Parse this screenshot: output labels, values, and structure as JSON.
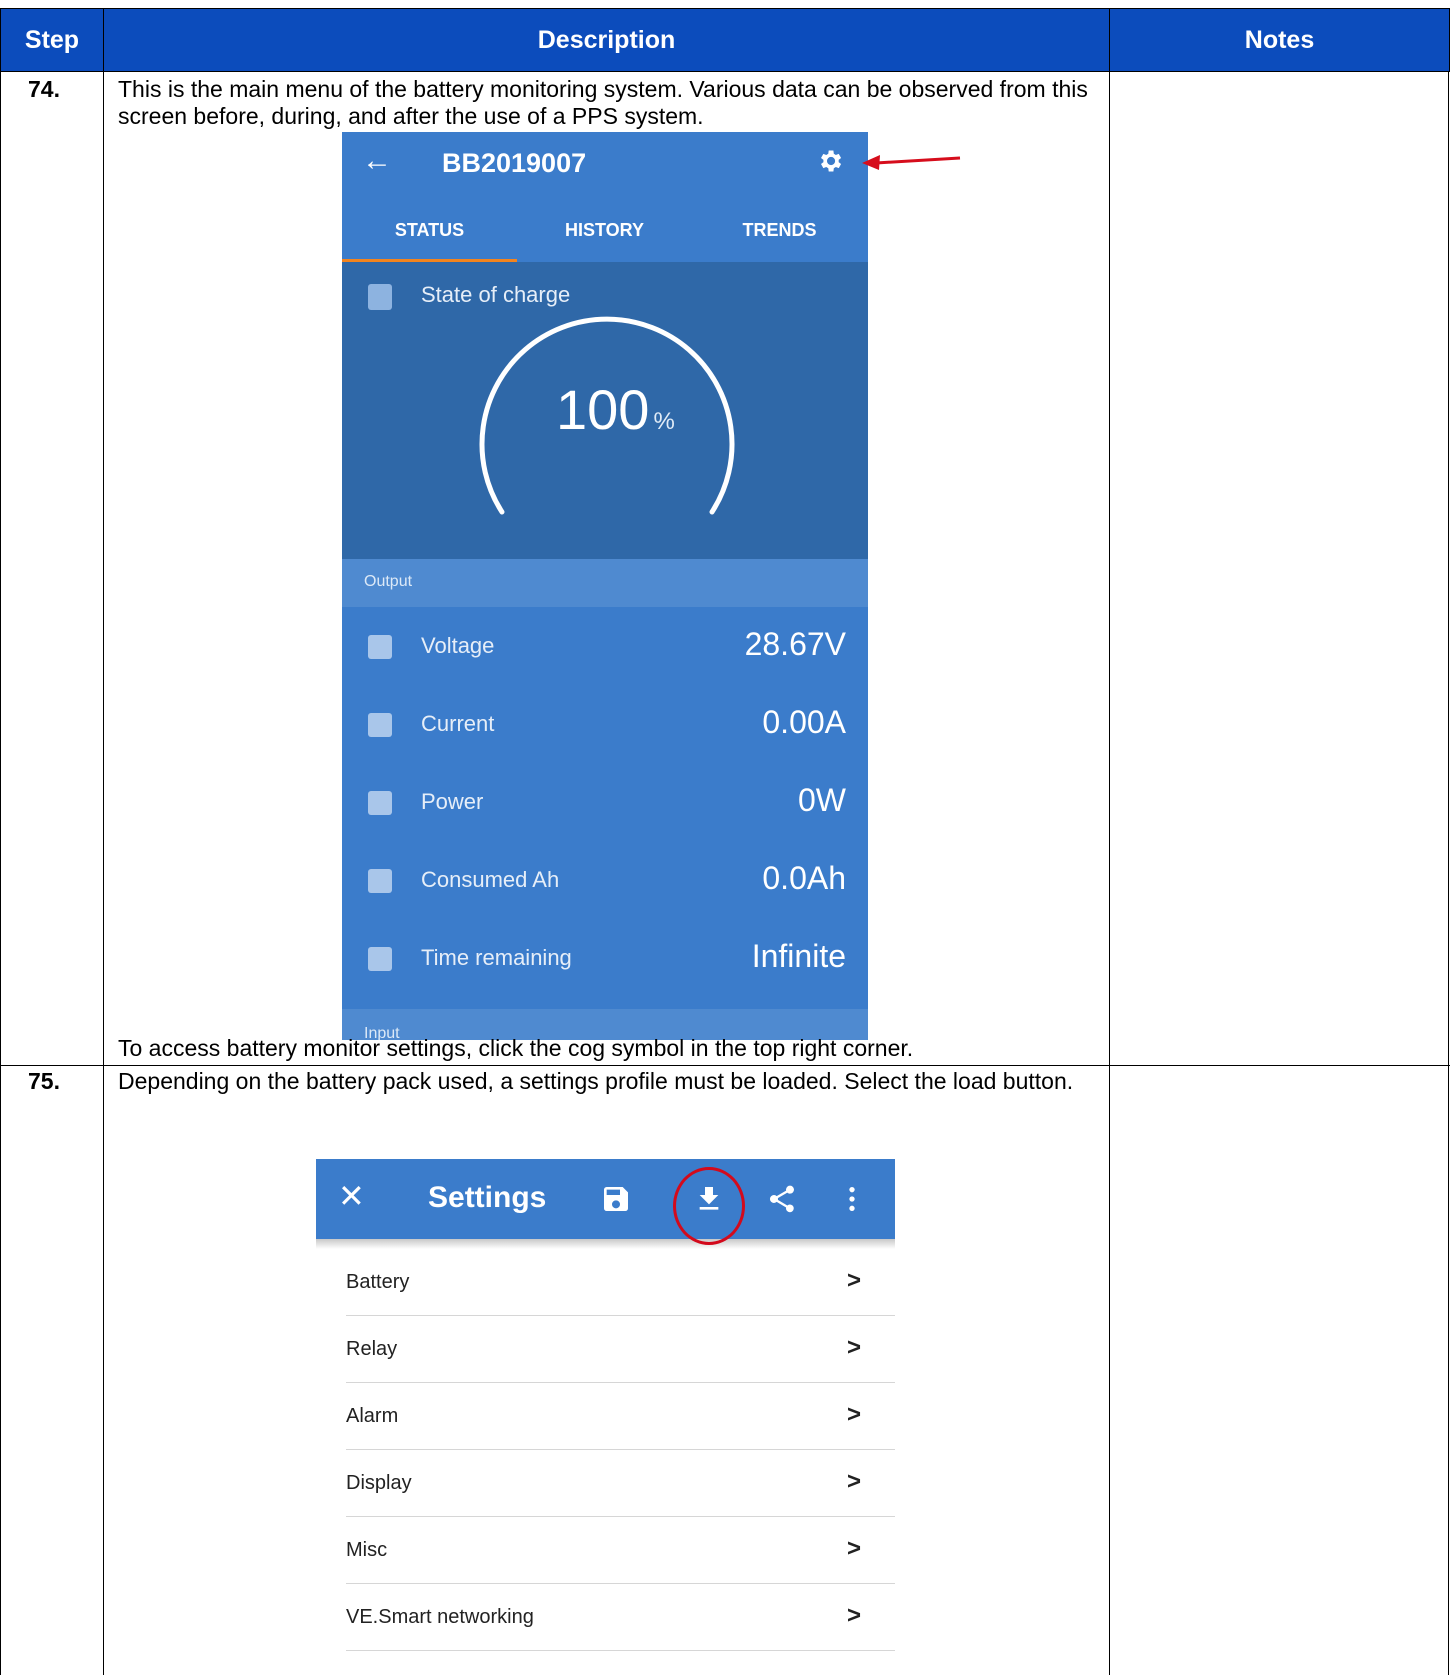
{
  "table": {
    "headers": {
      "step": "Step",
      "description": "Description",
      "notes": "Notes"
    }
  },
  "step74": {
    "number": "74.",
    "intro": "This is the main menu of the battery monitoring system. Various data can be observed from this screen before, during, and after the use of a PPS system.",
    "outro": "To access battery monitor settings, click the cog symbol in the top right corner."
  },
  "status_screen": {
    "title": "BB2019007",
    "tabs": [
      "STATUS",
      "HISTORY",
      "TRENDS"
    ],
    "active_tab": "STATUS",
    "soc_label": "State of charge",
    "soc_value": "100",
    "soc_unit": "%",
    "output_label": "Output",
    "rows": [
      {
        "label": "Voltage",
        "value": "28.67V",
        "icon": "voltage-icon"
      },
      {
        "label": "Current",
        "value": "0.00A",
        "icon": "current-icon"
      },
      {
        "label": "Power",
        "value": "0W",
        "icon": "power-icon"
      },
      {
        "label": "Consumed Ah",
        "value": "0.0Ah",
        "icon": "consumed-icon"
      },
      {
        "label": "Time remaining",
        "value": "Infinite",
        "icon": "clock-icon"
      }
    ],
    "input_label": "Input",
    "accent_color": "#3b7ccb",
    "tab_indicator_color": "#f3841e"
  },
  "step75": {
    "number": "75.",
    "text": "Depending on the battery pack used, a settings profile must be loaded. Select the load button."
  },
  "settings_screen": {
    "title": "Settings",
    "icons": [
      "close-icon",
      "save-icon",
      "load-icon",
      "share-icon",
      "more-icon"
    ],
    "items": [
      "Battery",
      "Relay",
      "Alarm",
      "Display",
      "Misc",
      "VE.Smart networking"
    ],
    "highlight_color": "#d30a1c"
  }
}
